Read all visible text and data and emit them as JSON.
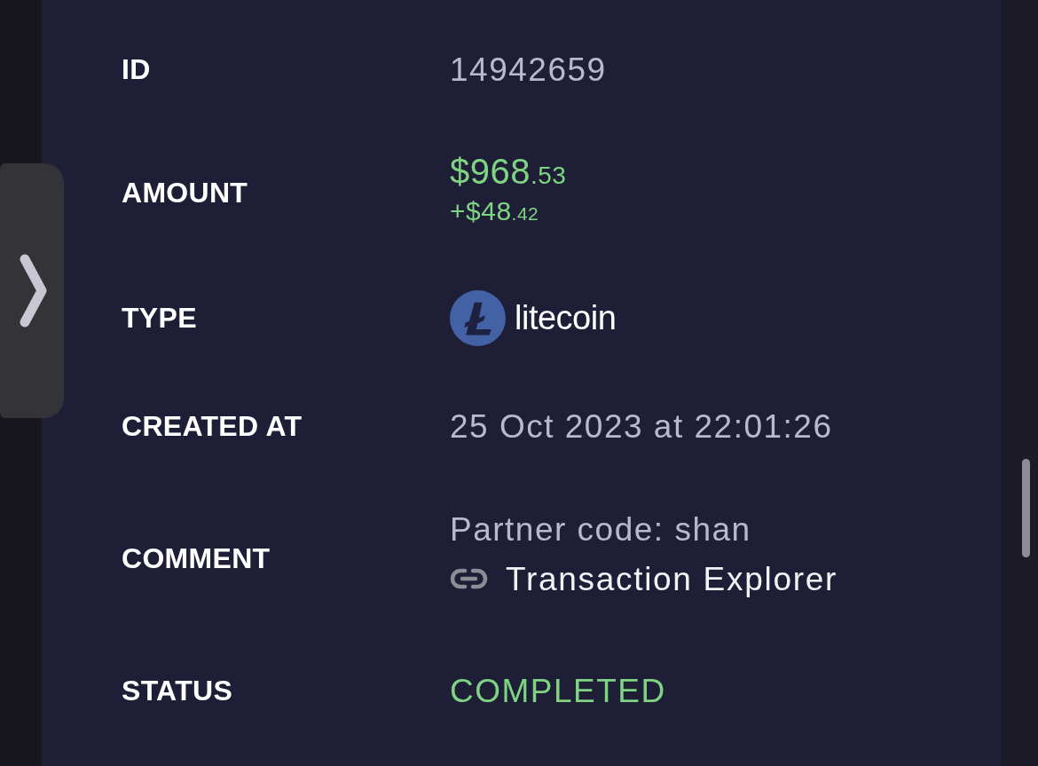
{
  "fields": [
    {
      "kind": "text",
      "label": "ID",
      "value": "14942659"
    },
    {
      "kind": "amount",
      "label": "AMOUNT",
      "amount": {
        "main": "$968",
        "fraction": ".53"
      },
      "change": {
        "main": "+$48",
        "fraction": ".42"
      }
    },
    {
      "kind": "currency",
      "label": "TYPE",
      "currency": "litecoin"
    },
    {
      "kind": "text",
      "label": "CREATED AT",
      "value": "25 Oct 2023 at 22:01:26"
    },
    {
      "kind": "comment",
      "label": "COMMENT",
      "note": "Partner code: shan",
      "link": "Transaction Explorer"
    },
    {
      "kind": "status",
      "label": "STATUS",
      "value": "COMPLETED"
    }
  ]
}
